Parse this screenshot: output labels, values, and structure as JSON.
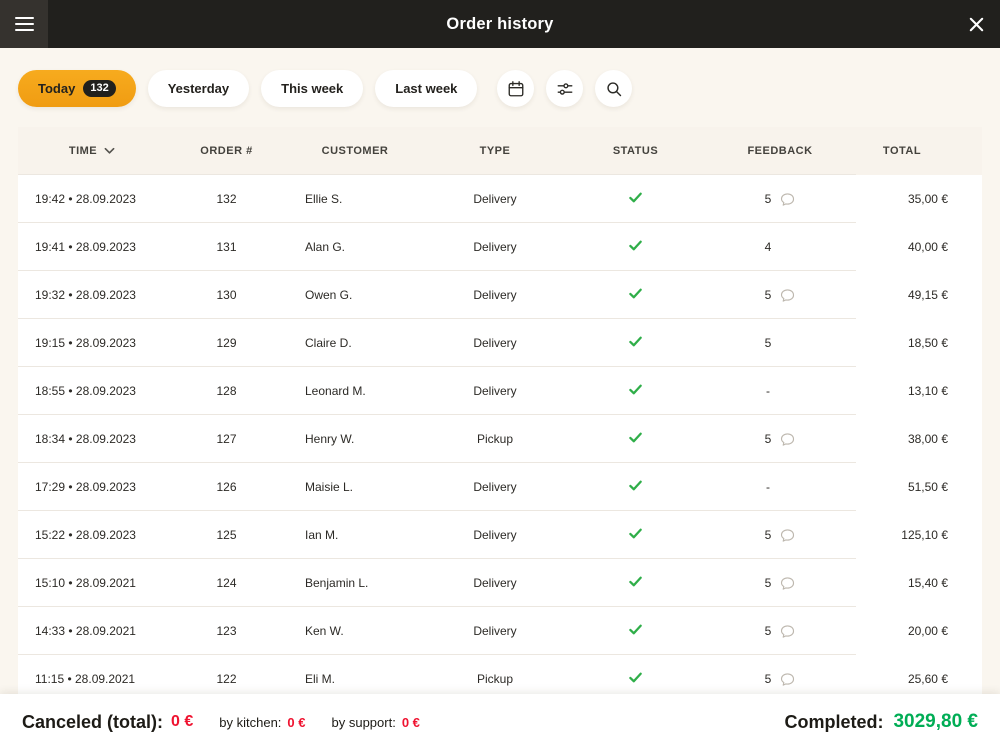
{
  "colors": {
    "accent_yellow": "#f7ab1e",
    "check_green": "#2fae49",
    "negative_red": "#ef1330",
    "completed_green": "#00ad55"
  },
  "header": {
    "title": "Order history"
  },
  "filters": {
    "tabs": [
      {
        "label": "Today",
        "badge": "132",
        "active": true
      },
      {
        "label": "Yesterday",
        "active": false
      },
      {
        "label": "This week",
        "active": false
      },
      {
        "label": "Last week",
        "active": false
      }
    ],
    "icon_buttons": [
      {
        "name": "calendar"
      },
      {
        "name": "filter-options"
      },
      {
        "name": "search"
      }
    ]
  },
  "table": {
    "columns": [
      "Time",
      "Order #",
      "Customer",
      "Type",
      "Status",
      "Feedback",
      "Total"
    ],
    "rows": [
      {
        "time": "19:42 • 28.09.2023",
        "order": "132",
        "customer": "Ellie S.",
        "type": "Delivery",
        "status": "completed",
        "feedback": "5",
        "comment": true,
        "total": "35,00 €"
      },
      {
        "time": "19:41 • 28.09.2023",
        "order": "131",
        "customer": "Alan G.",
        "type": "Delivery",
        "status": "completed",
        "feedback": "4",
        "comment": false,
        "total": "40,00 €"
      },
      {
        "time": "19:32 • 28.09.2023",
        "order": "130",
        "customer": "Owen G.",
        "type": "Delivery",
        "status": "completed",
        "feedback": "5",
        "comment": true,
        "total": "49,15 €"
      },
      {
        "time": "19:15 • 28.09.2023",
        "order": "129",
        "customer": "Claire D.",
        "type": "Delivery",
        "status": "completed",
        "feedback": "5",
        "comment": false,
        "total": "18,50 €"
      },
      {
        "time": "18:55 • 28.09.2023",
        "order": "128",
        "customer": "Leonard M.",
        "type": "Delivery",
        "status": "completed",
        "feedback": "-",
        "comment": false,
        "total": "13,10 €"
      },
      {
        "time": "18:34 • 28.09.2023",
        "order": "127",
        "customer": "Henry W.",
        "type": "Pickup",
        "status": "completed",
        "feedback": "5",
        "comment": true,
        "total": "38,00 €"
      },
      {
        "time": "17:29 • 28.09.2023",
        "order": "126",
        "customer": "Maisie L.",
        "type": "Delivery",
        "status": "completed",
        "feedback": "-",
        "comment": false,
        "total": "51,50 €"
      },
      {
        "time": "15:22 • 28.09.2023",
        "order": "125",
        "customer": "Ian M.",
        "type": "Delivery",
        "status": "completed",
        "feedback": "5",
        "comment": true,
        "total": "125,10 €"
      },
      {
        "time": "15:10 • 28.09.2021",
        "order": "124",
        "customer": "Benjamin L.",
        "type": "Delivery",
        "status": "completed",
        "feedback": "5",
        "comment": true,
        "total": "15,40 €"
      },
      {
        "time": "14:33 • 28.09.2021",
        "order": "123",
        "customer": "Ken W.",
        "type": "Delivery",
        "status": "completed",
        "feedback": "5",
        "comment": true,
        "total": "20,00 €"
      },
      {
        "time": "11:15 • 28.09.2021",
        "order": "122",
        "customer": "Eli M.",
        "type": "Pickup",
        "status": "completed",
        "feedback": "5",
        "comment": true,
        "total": "25,60 €"
      }
    ]
  },
  "footer": {
    "canceled_label": "Canceled (total):",
    "canceled_value": "0 €",
    "by_kitchen_label": "by kitchen:",
    "by_kitchen_value": "0 €",
    "by_support_label": "by support:",
    "by_support_value": "0 €",
    "completed_label": "Completed:",
    "completed_value": "3029,80 €"
  }
}
